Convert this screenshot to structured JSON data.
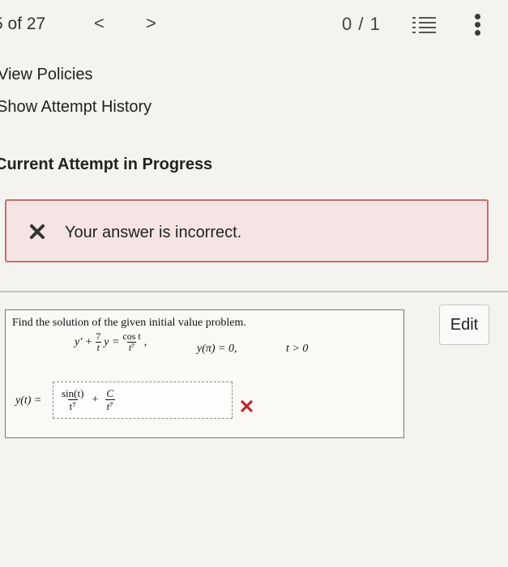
{
  "header": {
    "page_count": "5 of 27",
    "prev_symbol": "<",
    "next_symbol": ">",
    "score": "0 / 1",
    "list_icon": "list-icon",
    "more_icon": "more-vertical-icon"
  },
  "links": {
    "view_policies": "View Policies",
    "show_history": "Show Attempt History"
  },
  "section_title": "Current Attempt in Progress",
  "feedback": {
    "icon": "x-icon",
    "message": "Your answer is incorrect.",
    "bg_color": "#f6e4e4",
    "border_color": "#c56d6d",
    "icon_color": "#333333"
  },
  "problem": {
    "prompt": "Find the solution of the given initial value problem.",
    "ode": {
      "lhs_term1": "y′ +",
      "coef_num": "7",
      "coef_den": "t",
      "lhs_term2": "y =",
      "rhs_num": "cos t",
      "rhs_den": "t⁷",
      "trailing": ","
    },
    "initial_condition": "y(π) = 0,",
    "domain": "t > 0",
    "answer_label": "y(t) =",
    "answer": {
      "term1_num": "sin(t)",
      "term1_den": "t⁷",
      "op": "+",
      "term2_num": "C",
      "term2_den": "t⁷"
    },
    "status_icon": "wrong-x-icon",
    "status_color": "#c0282b"
  },
  "edit_button": "Edit"
}
